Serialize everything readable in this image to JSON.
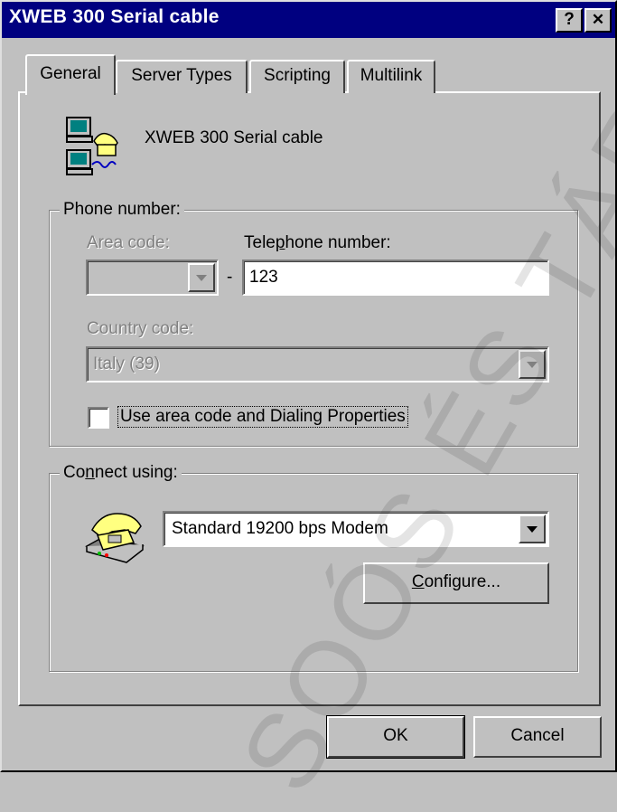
{
  "window": {
    "title": "XWEB 300 Serial cable",
    "help_label": "?",
    "close_label": "✕"
  },
  "tabs": [
    {
      "label": "General"
    },
    {
      "label": "Server Types"
    },
    {
      "label": "Scripting"
    },
    {
      "label": "Multilink"
    }
  ],
  "general": {
    "connection_name": "XWEB 300 Serial cable",
    "icon": "dialup-connection-icon",
    "phone_group": {
      "legend": "Phone number:",
      "area_code_label": "Area code:",
      "area_code_value": "",
      "separator": "-",
      "telephone_label": "Telephone number:",
      "telephone_value": "123",
      "country_code_label": "Country code:",
      "country_code_value": "Italy (39)",
      "use_area_code_checkbox_label": "Use area code and Dialing Properties",
      "use_area_code_checked": false
    },
    "connect_group": {
      "legend": "Connect using:",
      "modem_value": "Standard 19200 bps Modem",
      "configure_button": "Configure...",
      "icon": "telephone-modem-icon"
    }
  },
  "footer": {
    "ok_label": "OK",
    "cancel_label": "Cancel"
  },
  "watermark": "SOÓS ÉS TÁRS"
}
